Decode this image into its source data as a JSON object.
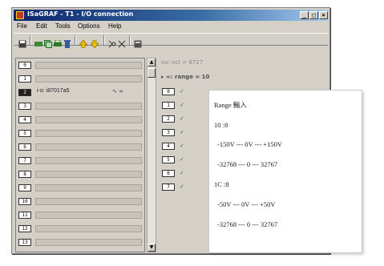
{
  "window": {
    "title": "ISaGRAF - T1 - I/O connection",
    "controls": [
      "_",
      "□",
      "×"
    ]
  },
  "menu": [
    "File",
    "Edit",
    "Tools",
    "Options",
    "Help"
  ],
  "toolbar": [
    "save-icon",
    "connect-icon",
    "copy-icon",
    "print-icon",
    "delete-icon",
    "up-icon",
    "down-icon",
    "cut-icon",
    "scissors-icon",
    "calc-icon"
  ],
  "channels": [
    {
      "num": "0",
      "name": "",
      "wave": ""
    },
    {
      "num": "1",
      "name": "",
      "wave": ""
    },
    {
      "num": "2",
      "name": "i-o: i87017a5",
      "wave": "∿ ≈"
    },
    {
      "num": "3",
      "name": "",
      "wave": ""
    },
    {
      "num": "4",
      "name": "",
      "wave": ""
    },
    {
      "num": "5",
      "name": "",
      "wave": ""
    },
    {
      "num": "6",
      "name": "",
      "wave": ""
    },
    {
      "num": "7",
      "name": "",
      "wave": ""
    },
    {
      "num": "8",
      "name": "",
      "wave": ""
    },
    {
      "num": "9",
      "name": "",
      "wave": ""
    },
    {
      "num": "10",
      "name": "",
      "wave": ""
    },
    {
      "num": "11",
      "name": "",
      "wave": ""
    },
    {
      "num": "12",
      "name": "",
      "wave": ""
    },
    {
      "num": "13",
      "name": "",
      "wave": ""
    }
  ],
  "scroll": {
    "up": "▲",
    "down": "▼"
  },
  "tree": {
    "line1": "oo: oct = 8727",
    "line2": "▸ ∞: range = 10"
  },
  "params": [
    "0",
    "1",
    "2",
    "3",
    "4",
    "5",
    "6",
    "7"
  ],
  "note": {
    "title": "Range 輸入",
    "sec1": "10 :8",
    "sec1_line1": "-150V  ---  0V   ---  +150V",
    "sec1_line2": "-32768  ---   0   ---  32767",
    "sec2": "1C :8",
    "sec2_line1": "-50V  ---  0V   ---  +50V",
    "sec2_line2": "-32768 ---   0   ---  32767"
  }
}
